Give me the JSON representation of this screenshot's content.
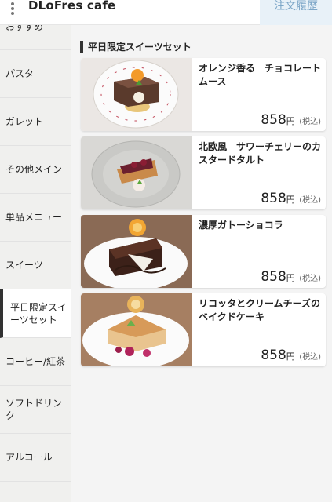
{
  "header": {
    "app_title": "DLoFres cafe",
    "history_label": "注文履歴",
    "menu_icon": "kebab-menu-icon"
  },
  "sidebar": {
    "items": [
      {
        "label": "おすすめ"
      },
      {
        "label": "パスタ"
      },
      {
        "label": "ガレット"
      },
      {
        "label": "その他メイン"
      },
      {
        "label": "単品メニュー"
      },
      {
        "label": "スイーツ"
      },
      {
        "label": "平日限定スイーツセット",
        "line1": "平日限定スイ",
        "line2": "ーツセット",
        "active": true
      },
      {
        "label": "コーヒー/紅茶"
      },
      {
        "label": "ソフトドリンク",
        "line1": "ソフトドリン",
        "line2": "ク"
      },
      {
        "label": "アルコール"
      }
    ]
  },
  "main": {
    "section_title": "平日限定スイーツセット",
    "products": [
      {
        "name": "オレンジ香る　チョコレートムース",
        "price": "858",
        "yen": "円",
        "tax": "(税込)"
      },
      {
        "name": "北欧風　サワーチェリーのカスタードタルト",
        "price": "858",
        "yen": "円",
        "tax": "(税込)"
      },
      {
        "name": "濃厚ガトーショコラ",
        "price": "858",
        "yen": "円",
        "tax": "(税込)"
      },
      {
        "name": "リコッタとクリームチーズのベイクドケーキ",
        "price": "858",
        "yen": "円",
        "tax": "(税込)"
      }
    ]
  },
  "colors": {
    "accent": "#333333",
    "history_bg": "#e8f1f8",
    "history_text": "#7ea7c8",
    "sidebar_bg": "#f0f0ee"
  }
}
